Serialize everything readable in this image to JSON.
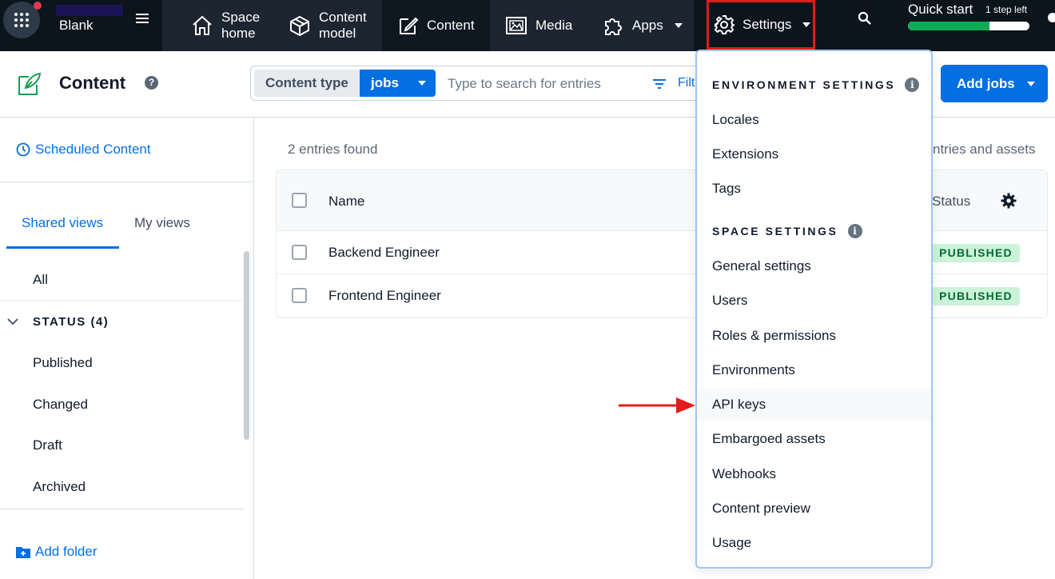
{
  "topnav": {
    "space_name": "Blank",
    "items": [
      {
        "label_line1": "Space",
        "label_line2": "home"
      },
      {
        "label_line1": "Content",
        "label_line2": "model"
      },
      {
        "label": "Content"
      },
      {
        "label": "Media"
      },
      {
        "label": "Apps"
      }
    ],
    "settings_label": "Settings",
    "quick_start": {
      "title": "Quick start",
      "sub": "1 step left",
      "progress": 0.67
    }
  },
  "header": {
    "title": "Content",
    "help_glyph": "?",
    "content_type_label": "Content type",
    "content_type_value": "jobs",
    "search_placeholder": "Type to search for entries",
    "filter_label": "Filt",
    "add_button_label": "Add jobs"
  },
  "sidebar": {
    "scheduled_label": "Scheduled Content",
    "tabs": [
      "Shared views",
      "My views"
    ],
    "views": {
      "all": "All",
      "status_header": "STATUS (4)",
      "status_items": [
        "Published",
        "Changed",
        "Draft",
        "Archived"
      ]
    },
    "add_folder_label": "Add folder"
  },
  "main": {
    "count_label": "2 entries found",
    "right_note": "ntries and assets",
    "columns": {
      "name": "Name",
      "status": "Status"
    },
    "rows": [
      {
        "name": "Backend Engineer",
        "status": "PUBLISHED"
      },
      {
        "name": "Frontend Engineer",
        "status": "PUBLISHED"
      }
    ]
  },
  "dropdown": {
    "environment_header": "ENVIRONMENT SETTINGS",
    "environment_items": [
      "Locales",
      "Extensions",
      "Tags"
    ],
    "space_header": "SPACE SETTINGS",
    "space_items": [
      "General settings",
      "Users",
      "Roles & permissions",
      "Environments",
      "API keys",
      "Embargoed assets",
      "Webhooks",
      "Content preview",
      "Usage"
    ],
    "info_glyph": "i"
  },
  "colors": {
    "nav_bg": "#0c141c",
    "accent_blue": "#036fe3",
    "highlight_red": "#e31b1b",
    "published_bg": "#ccf2da",
    "progress_green": "#0eab54"
  }
}
